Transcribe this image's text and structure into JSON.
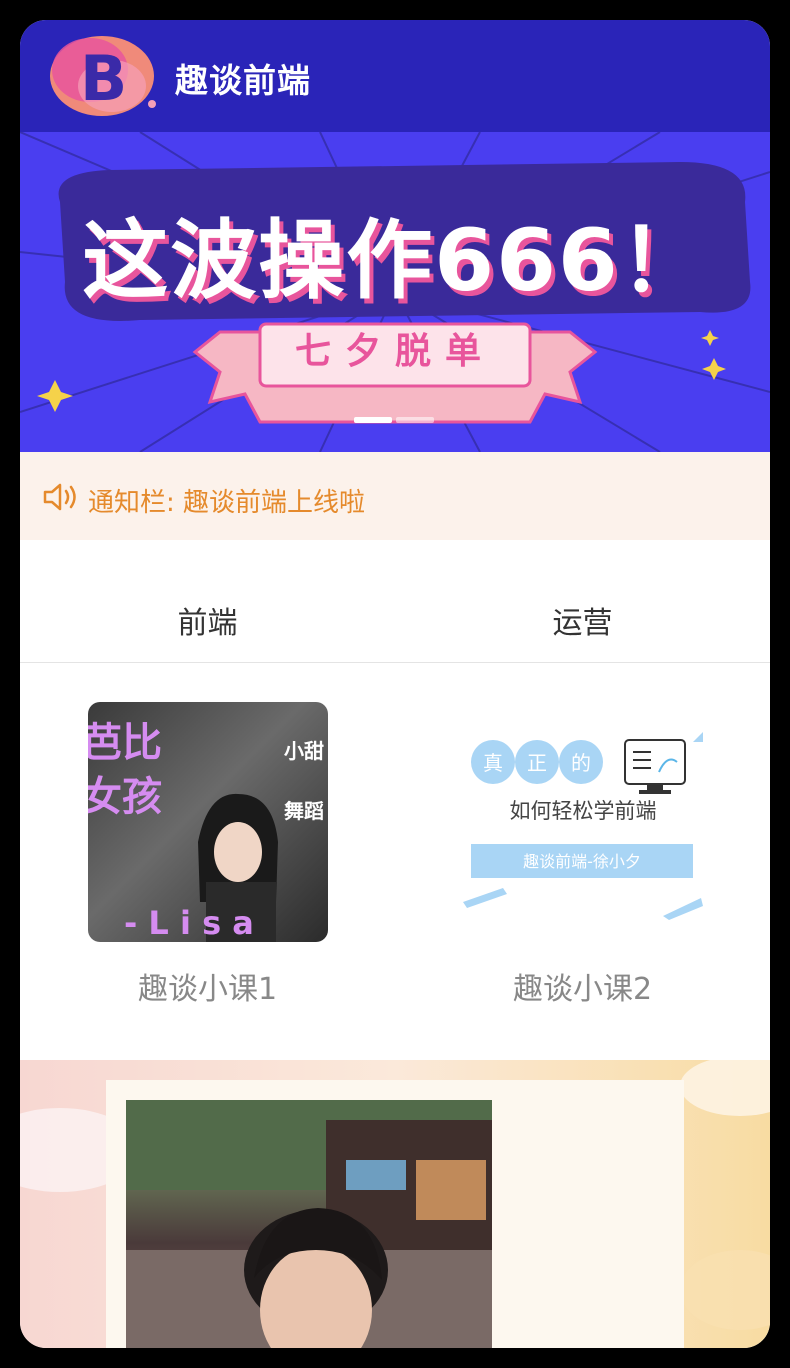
{
  "header": {
    "app_title": "趣谈前端",
    "logo_icon": "b-letter-logo-icon"
  },
  "banner": {
    "headline": "这波操作666！",
    "ribbon": "七夕脱单",
    "colors": {
      "background": "#4a3ef0",
      "accent": "#e8559c"
    },
    "slides_total": 2,
    "active_slide": 1
  },
  "notice": {
    "icon": "speaker-icon",
    "text": "通知栏: 趣谈前端上线啦",
    "color": "#e58a2c"
  },
  "tabs": [
    {
      "label": "前端",
      "active": true
    },
    {
      "label": "运营",
      "active": false
    }
  ],
  "courses": [
    {
      "title": "趣谈小课1",
      "thumb_text": [
        "芭比",
        "女孩",
        "小甜",
        "舞蹈",
        "- L i s a"
      ]
    },
    {
      "title": "趣谈小课2",
      "thumb_text": [
        "真",
        "正",
        "的",
        "如何轻松学前端",
        "趣谈前端-徐小夕"
      ]
    }
  ],
  "promo": {
    "image": "portrait-photo"
  }
}
